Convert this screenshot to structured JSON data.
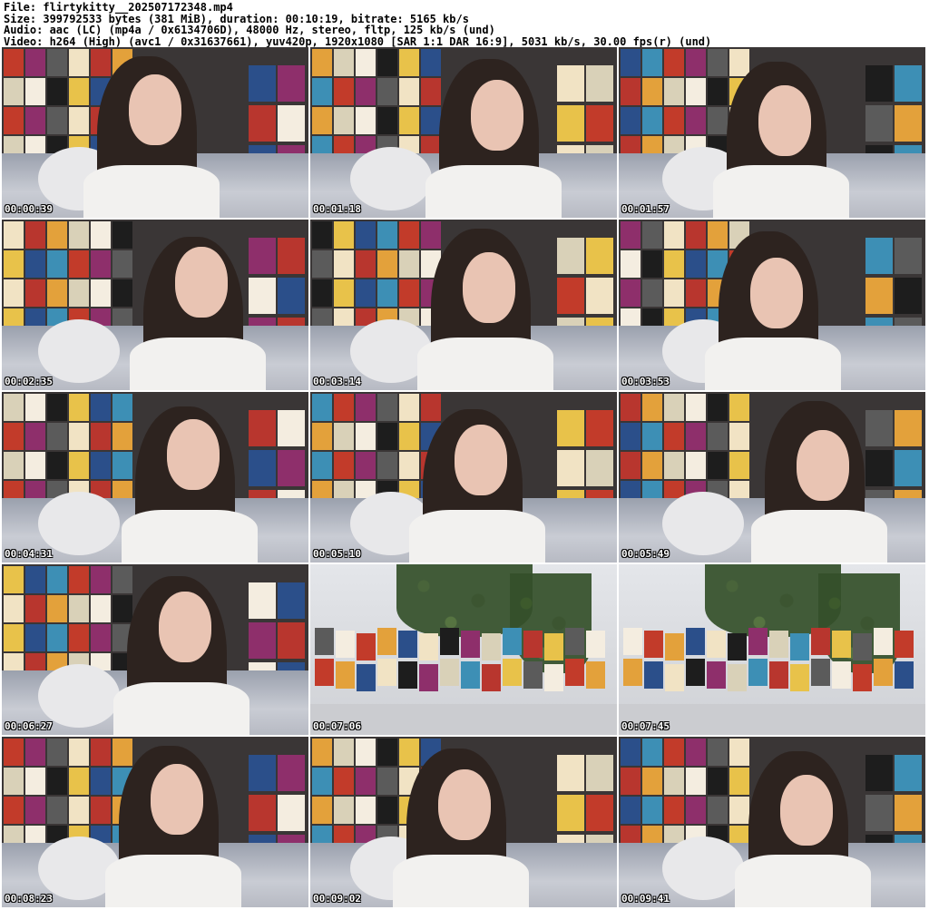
{
  "header": {
    "file_line": "File: flirtykitty__202507172348.mp4",
    "size_line": "Size: 399792533 bytes (381 MiB), duration: 00:10:19, bitrate: 5165 kb/s",
    "audio_line": "Audio: aac (LC) (mp4a / 0x6134706D), 48000 Hz, stereo, fltp, 125 kb/s (und)",
    "video_line": "Video: h264 (High) (avc1 / 0x31637661), yuv420p, 1920x1080 [SAR 1:1 DAR 16:9], 5031 kb/s, 30.00 fps(r) (und)"
  },
  "thumbnails": [
    {
      "time": "00:00:39",
      "scene": "closeup"
    },
    {
      "time": "00:01:18",
      "scene": "closeup"
    },
    {
      "time": "00:01:57",
      "scene": "closeup"
    },
    {
      "time": "00:02:35",
      "scene": "closeup"
    },
    {
      "time": "00:03:14",
      "scene": "closeup"
    },
    {
      "time": "00:03:53",
      "scene": "closeup"
    },
    {
      "time": "00:04:31",
      "scene": "closeup"
    },
    {
      "time": "00:05:10",
      "scene": "closeup"
    },
    {
      "time": "00:05:49",
      "scene": "closeup"
    },
    {
      "time": "00:06:27",
      "scene": "closeup"
    },
    {
      "time": "00:07:06",
      "scene": "wide-room"
    },
    {
      "time": "00:07:45",
      "scene": "wide-room"
    },
    {
      "time": "00:08:23",
      "scene": "closeup"
    },
    {
      "time": "00:09:02",
      "scene": "closeup"
    },
    {
      "time": "00:09:41",
      "scene": "closeup"
    }
  ],
  "colors": {
    "background": "#ffffff",
    "timestamp_text": "#ffffff",
    "timestamp_outline": "#000000"
  }
}
